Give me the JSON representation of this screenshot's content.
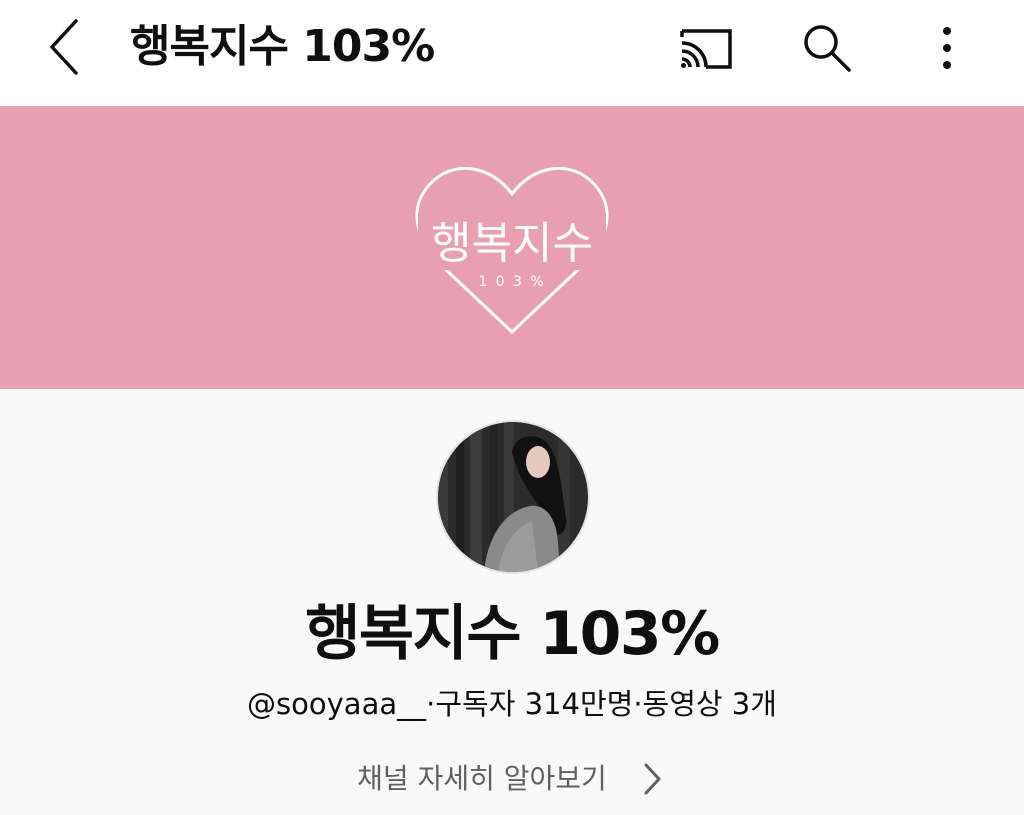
{
  "header": {
    "title": "행복지수 103%",
    "back_icon": "chevron-left-icon",
    "cast_icon": "cast-icon",
    "search_icon": "search-icon",
    "more_icon": "more-vertical-icon"
  },
  "banner": {
    "background_color": "#e8a0b0",
    "logo_text": "행복지수",
    "logo_subtext": "1 0 3 %"
  },
  "channel": {
    "name": "행복지수 103%",
    "handle": "@sooyaaa__",
    "separator": "·",
    "subscribers": "구독자 314만명",
    "videos": "동영상 3개",
    "details_label": "채널 자세히 알아보기"
  },
  "colors": {
    "text_primary": "#0f0f0f",
    "text_secondary": "#606060",
    "page_background": "#f9f9f9"
  }
}
